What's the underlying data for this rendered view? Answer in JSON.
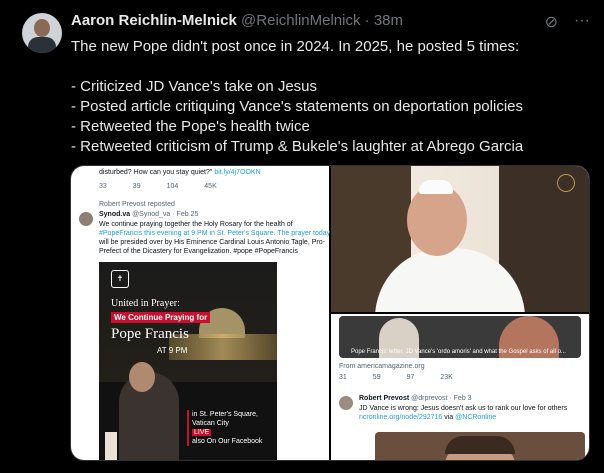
{
  "author": {
    "name": "Aaron Reichlin-Melnick",
    "handle": "@ReichlinMelnick",
    "separator": "·",
    "time": "38m"
  },
  "header_icons": [
    "grok-icon",
    "more-icon"
  ],
  "header_glyphs": {
    "grok": "⊘",
    "more": "···"
  },
  "tweet": {
    "lines": [
      "The new Pope didn't post once in 2024. In 2025, he posted 5 times:",
      "",
      "- Criticized JD Vance's take on Jesus",
      "- Posted article critiquing Vance's statements on deportation policies",
      "- Retweeted the Pope's health twice",
      "- Retweeted criticism of Trump & Bukele's laughter at Abrego Garcia"
    ]
  },
  "media": {
    "left": {
      "top_text": "disturbed? How can you stay quiet?\"",
      "top_link": "bit.ly/4j7OOKN",
      "top_stats": [
        "33",
        "39",
        "104",
        "45K"
      ],
      "repost_label": "Robert Prevost reposted",
      "account": "Synod.va",
      "account_handle": "@Synod_va · Feb 25",
      "body": [
        "We continue praying together the Holy Rosary for the health of",
        "#PopeFrancis  this evening at 9 PM in St. Peter's Square. The prayer today",
        "will be presided over by His Eminence Cardinal Louis Antonio Tagle, Pro-",
        "Prefect of the Dicastery for Evangelization. #pope #PopeFrancis"
      ],
      "poster": {
        "title": "United in Prayer:",
        "subtitle": "We Continue Praying for",
        "name": "Pope Francis",
        "time": "AT 9 PM",
        "location_1": "in St. Peter's Square,",
        "location_2": "Vatican City",
        "live": "LIVE",
        "facebook": "also On Our Facebook"
      }
    },
    "bottom_right": {
      "caption": "Pope Francis' letter, JD Vance's 'ordo amoris' and what the Gospel asks of all o...",
      "source": "From americamagazine.org",
      "stats": [
        "31",
        "59",
        "97",
        "23K"
      ],
      "author": "Robert Prevost",
      "author_handle": "@drprevost · Feb 3",
      "text": "JD Vance is wrong: Jesus doesn't ask us to rank our love for others",
      "link": "ncronline.org/node/292716",
      "via": "via",
      "mention": "@NCRonline"
    }
  }
}
